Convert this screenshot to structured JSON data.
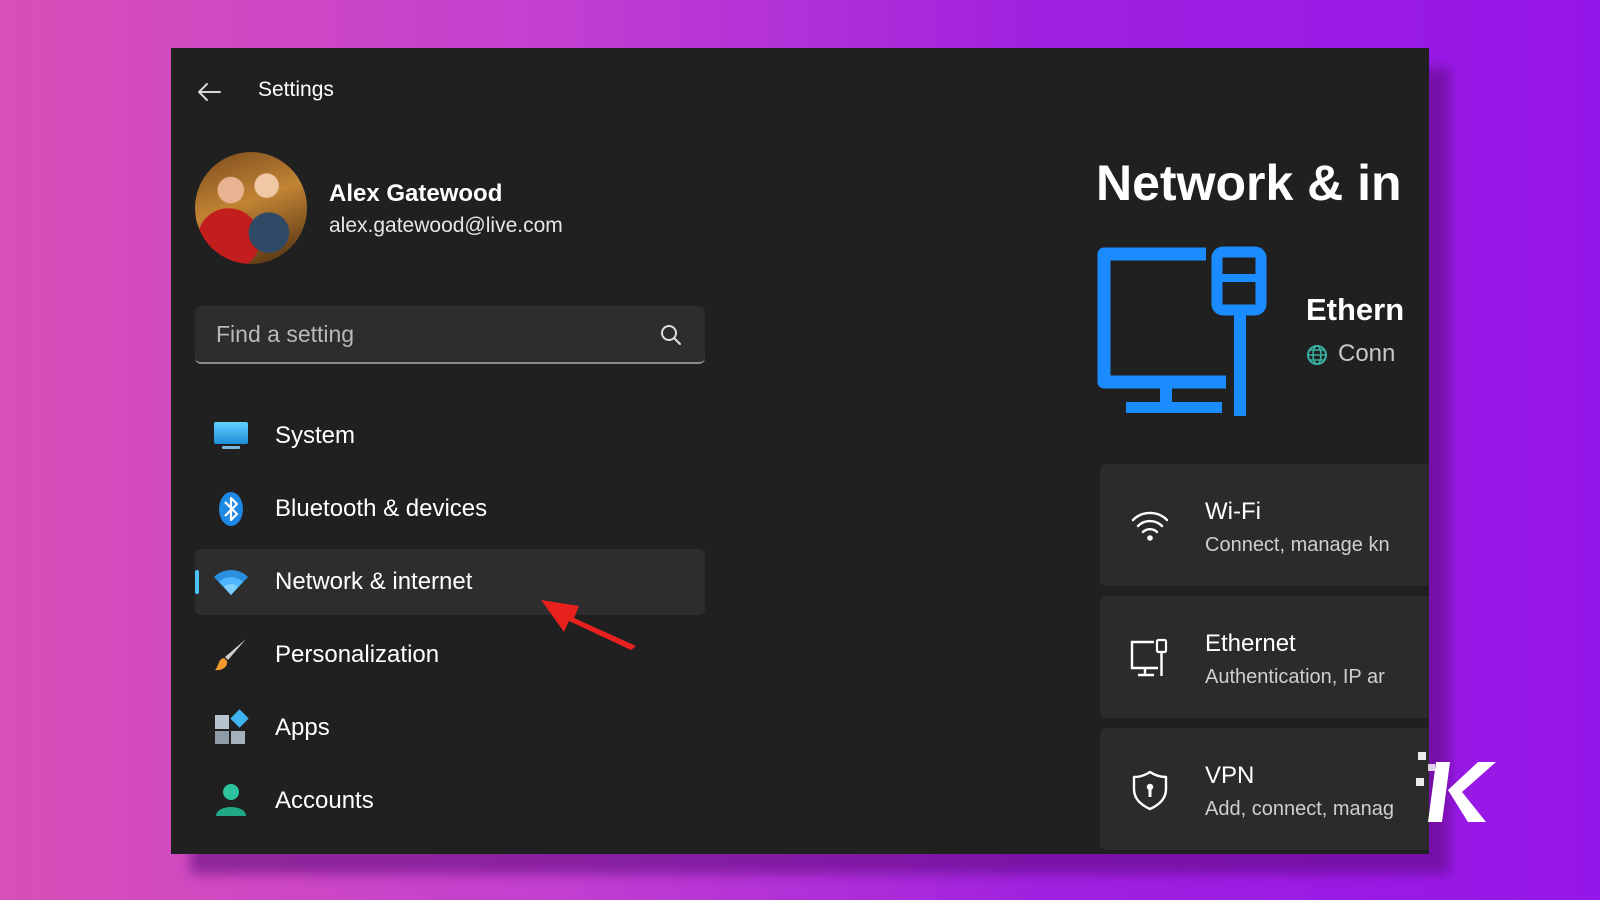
{
  "window": {
    "title": "Settings"
  },
  "profile": {
    "name": "Alex Gatewood",
    "email": "alex.gatewood@live.com"
  },
  "search": {
    "placeholder": "Find a setting"
  },
  "nav": {
    "items": [
      {
        "label": "System",
        "icon": "system-icon"
      },
      {
        "label": "Bluetooth & devices",
        "icon": "bluetooth-icon"
      },
      {
        "label": "Network & internet",
        "icon": "wifi-icon",
        "selected": true
      },
      {
        "label": "Personalization",
        "icon": "brush-icon"
      },
      {
        "label": "Apps",
        "icon": "apps-icon"
      },
      {
        "label": "Accounts",
        "icon": "person-icon"
      }
    ]
  },
  "main": {
    "title": "Network & in",
    "hero": {
      "title": "Ethern",
      "status": "Conn"
    },
    "cards": [
      {
        "title": "Wi-Fi",
        "subtitle": "Connect, manage kn",
        "icon": "wifi-icon"
      },
      {
        "title": "Ethernet",
        "subtitle": "Authentication, IP ar",
        "icon": "ethernet-icon"
      },
      {
        "title": "VPN",
        "subtitle": "Add, connect, manag",
        "icon": "shield-icon"
      }
    ]
  },
  "colors": {
    "accent": "#4cc2ff",
    "hero_icon": "#1a8cff",
    "window_bg": "#202020",
    "arrow": "#e8201e"
  }
}
